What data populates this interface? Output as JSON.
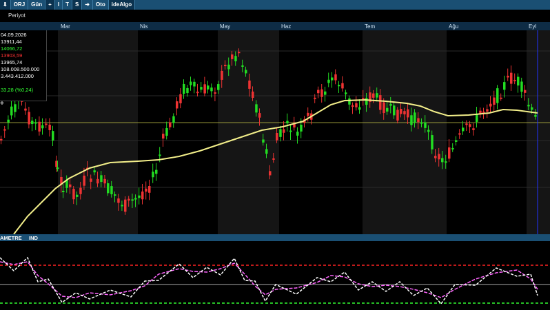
{
  "toolbar": {
    "items": [
      {
        "label": "⬇",
        "name": "download-icon"
      },
      {
        "label": "ORJ",
        "name": "orj-button"
      },
      {
        "label": "Gün",
        "name": "period-gun-button"
      },
      {
        "label": "+",
        "name": "plus-button"
      },
      {
        "label": "I",
        "name": "i-button"
      },
      {
        "label": "T",
        "name": "t-button"
      },
      {
        "label": "S",
        "name": "s-button"
      },
      {
        "label": "➜",
        "name": "arrow-icon"
      },
      {
        "label": "Oto",
        "name": "oto-button"
      },
      {
        "label": "ideAlgo",
        "name": "idealgo-button"
      }
    ]
  },
  "periyot": {
    "label": "Periyot"
  },
  "months": [
    "Mar",
    "Nis",
    "May",
    "Haz",
    "Tem",
    "Ağu",
    "Eyl"
  ],
  "info": {
    "date": "04.09.2026",
    "open": "13911,44",
    "high": "14066,72",
    "low": "13903,59",
    "close": "13965,74",
    "volume": "108.008.500.000",
    "amount": "3.443.412.000",
    "change": "33,28 (%0,24)"
  },
  "info_colors": {
    "open": "#ffffff",
    "high": "#33ff33",
    "low": "#ff3333",
    "change": "#33ff33"
  },
  "indicator_tabs": [
    "AMETRE",
    "IND"
  ],
  "colors": {
    "up": "#22dd22",
    "down": "#ee3333",
    "ma": "#f3ef8a",
    "rsi": "#ff66ff",
    "stoch": "#ffffff"
  }
}
